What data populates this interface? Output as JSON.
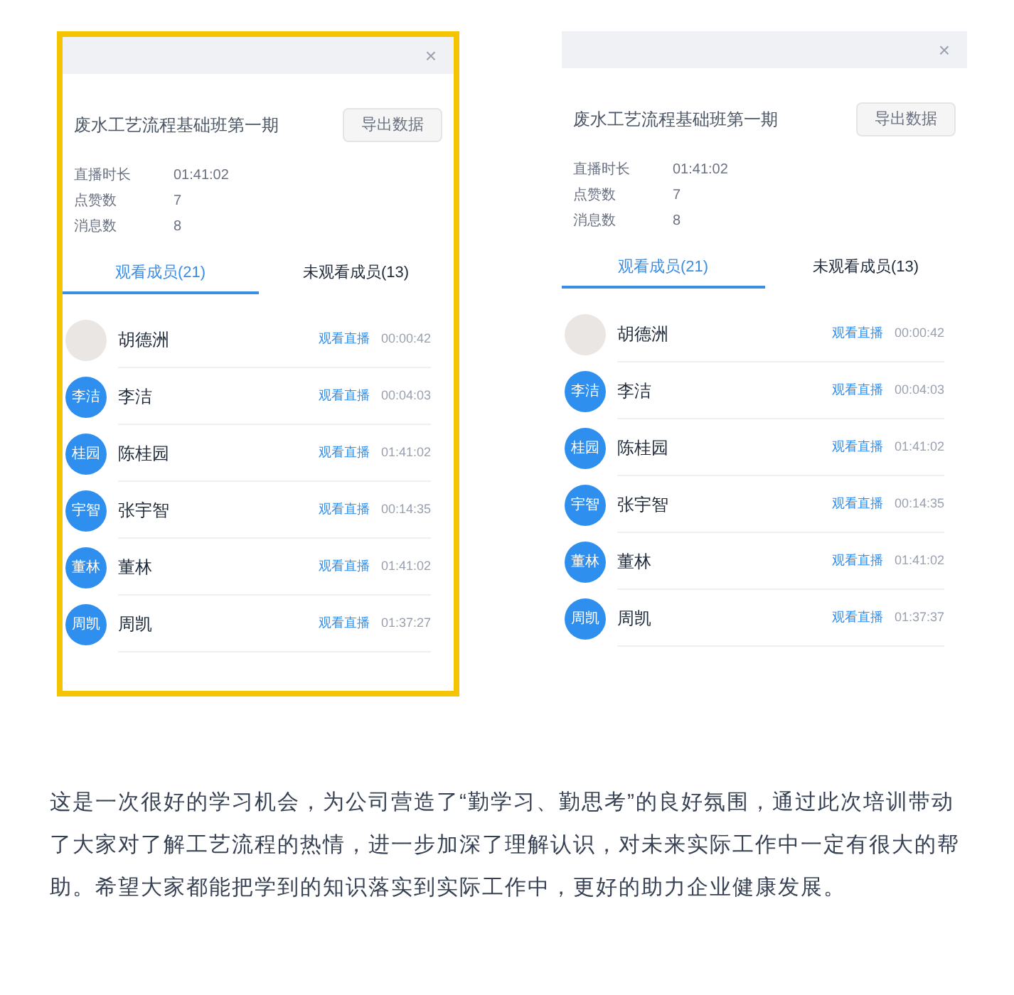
{
  "screenshots": [
    {
      "highlighted": true,
      "close": "×",
      "course_title": "废水工艺流程基础班第一期",
      "export_button": "导出数据",
      "stats": [
        {
          "label": "直播时长",
          "value": "01:41:02"
        },
        {
          "label": "点赞数",
          "value": "7"
        },
        {
          "label": "消息数",
          "value": "8"
        }
      ],
      "tabs": [
        {
          "label": "观看成员(21)",
          "selected": true
        },
        {
          "label": "未观看成员(13)",
          "selected": false
        }
      ],
      "members": [
        {
          "kind": "photo",
          "name": "胡德洲",
          "action": "观看直播",
          "time": "00:00:42"
        },
        {
          "kind": "initials",
          "initials": "李洁",
          "name": "李洁",
          "action": "观看直播",
          "time": "00:04:03"
        },
        {
          "kind": "initials",
          "initials": "桂园",
          "name": "陈桂园",
          "action": "观看直播",
          "time": "01:41:02"
        },
        {
          "kind": "initials",
          "initials": "宇智",
          "name": "张宇智",
          "action": "观看直播",
          "time": "00:14:35"
        },
        {
          "kind": "initials",
          "initials": "董林",
          "name": "董林",
          "action": "观看直播",
          "time": "01:41:02"
        },
        {
          "kind": "initials",
          "initials": "周凯",
          "name": "周凯",
          "action": "观看直播",
          "time": "01:37:27"
        }
      ]
    },
    {
      "highlighted": false,
      "close": "×",
      "course_title": "废水工艺流程基础班第一期",
      "export_button": "导出数据",
      "stats": [
        {
          "label": "直播时长",
          "value": "01:41:02"
        },
        {
          "label": "点赞数",
          "value": "7"
        },
        {
          "label": "消息数",
          "value": "8"
        }
      ],
      "tabs": [
        {
          "label": "观看成员(21)",
          "selected": true
        },
        {
          "label": "未观看成员(13)",
          "selected": false
        }
      ],
      "members": [
        {
          "kind": "photo",
          "name": "胡德洲",
          "action": "观看直播",
          "time": "00:00:42"
        },
        {
          "kind": "initials",
          "initials": "李洁",
          "name": "李洁",
          "action": "观看直播",
          "time": "00:04:03"
        },
        {
          "kind": "initials",
          "initials": "桂园",
          "name": "陈桂园",
          "action": "观看直播",
          "time": "01:41:02"
        },
        {
          "kind": "initials",
          "initials": "宇智",
          "name": "张宇智",
          "action": "观看直播",
          "time": "00:14:35"
        },
        {
          "kind": "initials",
          "initials": "董林",
          "name": "董林",
          "action": "观看直播",
          "time": "01:41:02"
        },
        {
          "kind": "initials",
          "initials": "周凯",
          "name": "周凯",
          "action": "观看直播",
          "time": "01:37:37"
        }
      ]
    }
  ],
  "paragraph": "这是一次很好的学习机会，为公司营造了“勤学习、勤思考”的良好氛围，通过此次培训带动了大家对了解工艺流程的热情，进一步加深了理解认识，对未来实际工作中一定有很大的帮助。希望大家都能把学到的知识落实到实际工作中，更好的助力企业健康发展。"
}
